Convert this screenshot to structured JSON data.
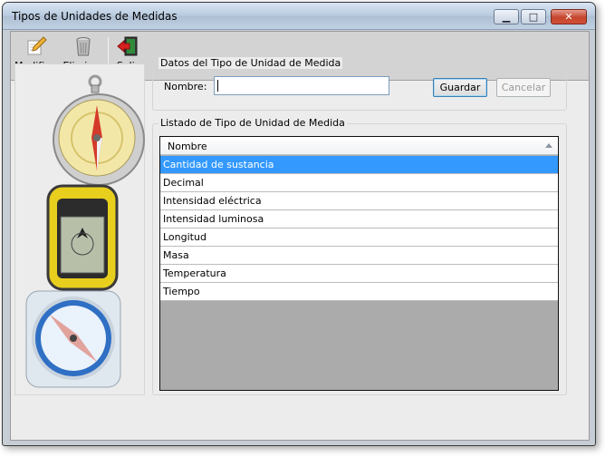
{
  "window": {
    "title": "Tipos de Unidades de Medidas",
    "min_glyph": "▁",
    "max_glyph": "□",
    "close_glyph": "✕"
  },
  "toolbar": {
    "modify_label": "Modificar",
    "delete_label": "Eliminar",
    "exit_label": "Salir"
  },
  "data_group": {
    "title": "Datos del Tipo de Unidad de Medida",
    "name_label": "Nombre:",
    "name_value": "",
    "save_label": "Guardar",
    "cancel_label": "Cancelar"
  },
  "list_group": {
    "title": "Listado de Tipo de Unidad de Medida",
    "column_header": "Nombre",
    "rows": [
      "Cantidad de sustancia",
      "Decimal",
      "Intensidad eléctrica",
      "Intensidad luminosa",
      "Longitud",
      "Masa",
      "Temperatura",
      "Tiempo"
    ],
    "selected_index": 0
  }
}
